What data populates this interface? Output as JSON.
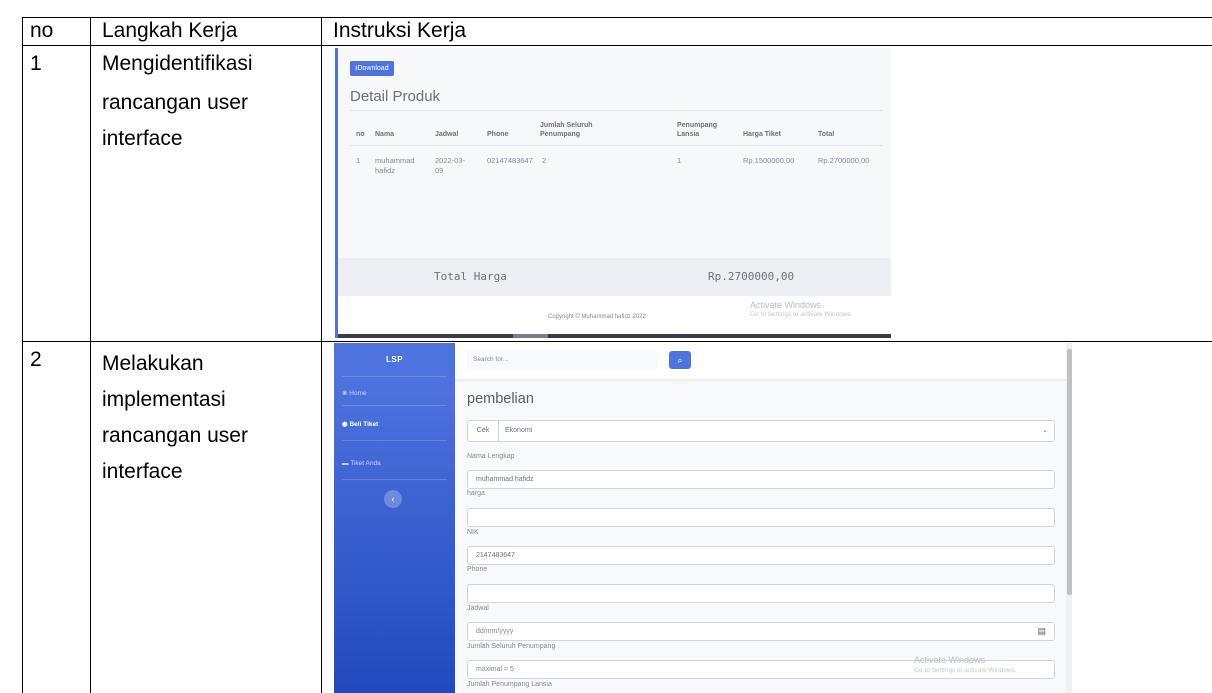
{
  "table": {
    "headers": [
      "no",
      "Langkah Kerja",
      "Instruksi Kerja"
    ],
    "rows": [
      {
        "no": "1",
        "langkah": [
          "Mengidentifikasi",
          "rancangan user",
          "interface"
        ]
      },
      {
        "no": "2",
        "langkah": [
          "Melakukan",
          "implementasi",
          "rancangan user",
          "interface"
        ]
      }
    ]
  },
  "screenshot1": {
    "download_label": "⭳Download",
    "title": "Detail Produk",
    "columns": [
      "no",
      "Nama",
      "Jadwal",
      "Phone",
      "Jumlah Seluruh Penumpang",
      "Penumpang Lansia",
      "Harga Tiket",
      "Total"
    ],
    "row": {
      "no": "1",
      "nama": "muhammad hafidz",
      "jadwal": "2022-03-09",
      "phone": "02147483647",
      "jumlah": "2",
      "lansia": "1",
      "harga": "Rp.1500000,00",
      "total": "Rp.2700000,00"
    },
    "total_label": "Total Harga",
    "total_value": "Rp.2700000,00",
    "copyright": "Copyright © Muhammad hafidz 2022",
    "watermark_title": "Activate Windows",
    "watermark_sub": "Go to Settings to activate Windows."
  },
  "screenshot2": {
    "brand": "LSP",
    "nav": [
      {
        "label": "Home",
        "icon": "palette-icon"
      },
      {
        "label": "Beli Tiket",
        "icon": "globe-icon"
      },
      {
        "label": "Tiket Anda",
        "icon": "folder-icon"
      }
    ],
    "sidebar_toggle": "‹",
    "search_placeholder": "Search for...",
    "search_icon": "🔍",
    "heading": "pembelian",
    "cek_label": "Cek",
    "class_value": "Ekonomi",
    "fields": {
      "nama_label": "Nama Lengkap",
      "nama_value": "muhammad hafidz",
      "harga_label": "harga",
      "harga_value": "",
      "nik_label": "NIK",
      "nik_value": "2147483647",
      "phone_label": "Phone",
      "phone_value": "",
      "jadwal_label": "Jadwal",
      "jadwal_placeholder": "dd/mm/yyyy",
      "jumlah_label": "Jumlah Seluruh Penumpang",
      "jumlah_placeholder": "maximal = 5",
      "lansia_label": "Jumlah Penumpang Lansia"
    },
    "watermark_title": "Activate Windows",
    "watermark_sub": "Go to Settings to activate Windows."
  }
}
